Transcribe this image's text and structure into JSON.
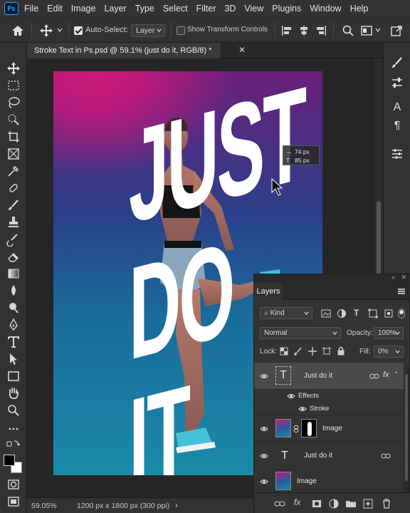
{
  "app": {
    "logo": "Ps"
  },
  "menu": [
    "File",
    "Edit",
    "Image",
    "Layer",
    "Type",
    "Select",
    "Filter",
    "3D",
    "View",
    "Plugins",
    "Window",
    "Help"
  ],
  "options": {
    "auto_select_label": "Auto-Select:",
    "auto_select_checked": true,
    "auto_select_target": "Layer",
    "show_transform_label": "Show Transform Controls",
    "show_transform_checked": false
  },
  "document": {
    "tab_title": "Stroke Text in Ps.psd @ 59.1% (just do it, RGB/8) *",
    "headline_line1": "JUST",
    "headline_line2": "DO IT",
    "hud_line1": "74 px",
    "hud_line2": "85 px"
  },
  "status": {
    "zoom": "59.05%",
    "doc_info": "1200 px x 1800 px (300 ppi)"
  },
  "layers_panel": {
    "tab_label": "Layers",
    "filter_kind": "Kind",
    "blend_mode": "Normal",
    "opacity_label": "Opacity:",
    "opacity_value": "100%",
    "lock_label": "Lock:",
    "fill_label": "Fill:",
    "fill_value": "0%",
    "layers": [
      {
        "name": "Just do it",
        "type": "text",
        "selected": true,
        "fx": true
      },
      {
        "name": "Effects",
        "type": "effects-group"
      },
      {
        "name": "Stroke",
        "type": "effect"
      },
      {
        "name": "Image",
        "type": "image-masked"
      },
      {
        "name": "Just do it",
        "type": "text",
        "selected": false,
        "fx": false
      },
      {
        "name": "Image",
        "type": "image"
      }
    ]
  },
  "colors": {
    "accent": "#31a8ff",
    "magenta": "#d1187b",
    "teal": "#1a8aa8"
  }
}
